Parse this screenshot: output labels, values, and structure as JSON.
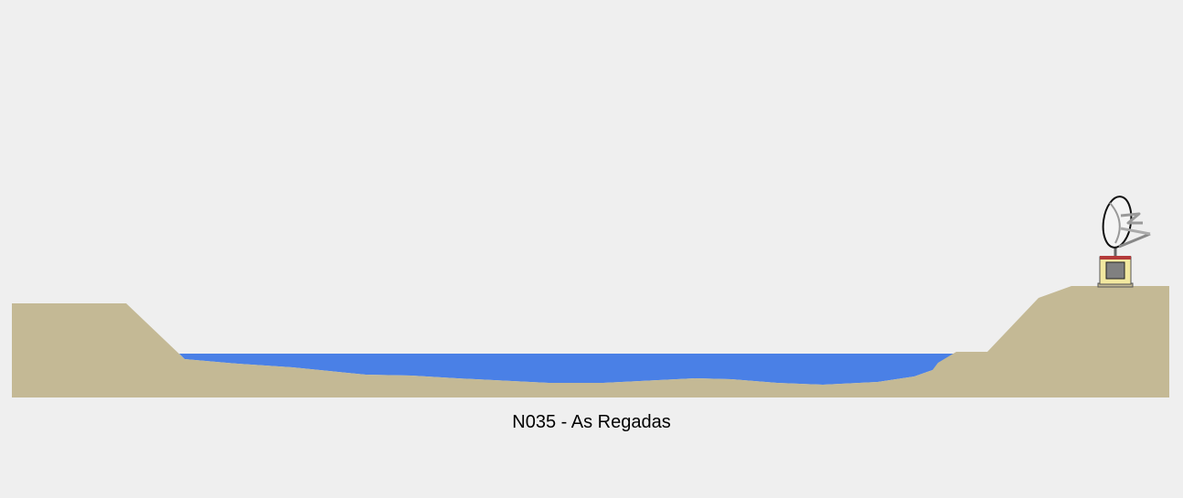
{
  "station": {
    "label": "N035 - As Regadas"
  },
  "colors": {
    "background": "#efefef",
    "terrain": "#c4b995",
    "water": "#4a80e6",
    "antenna_box_fill": "#f2e8a0",
    "antenna_box_inner": "#808080",
    "antenna_box_top": "#b33a3a"
  },
  "icons": {
    "station_marker": "satellite-dish-icon"
  }
}
